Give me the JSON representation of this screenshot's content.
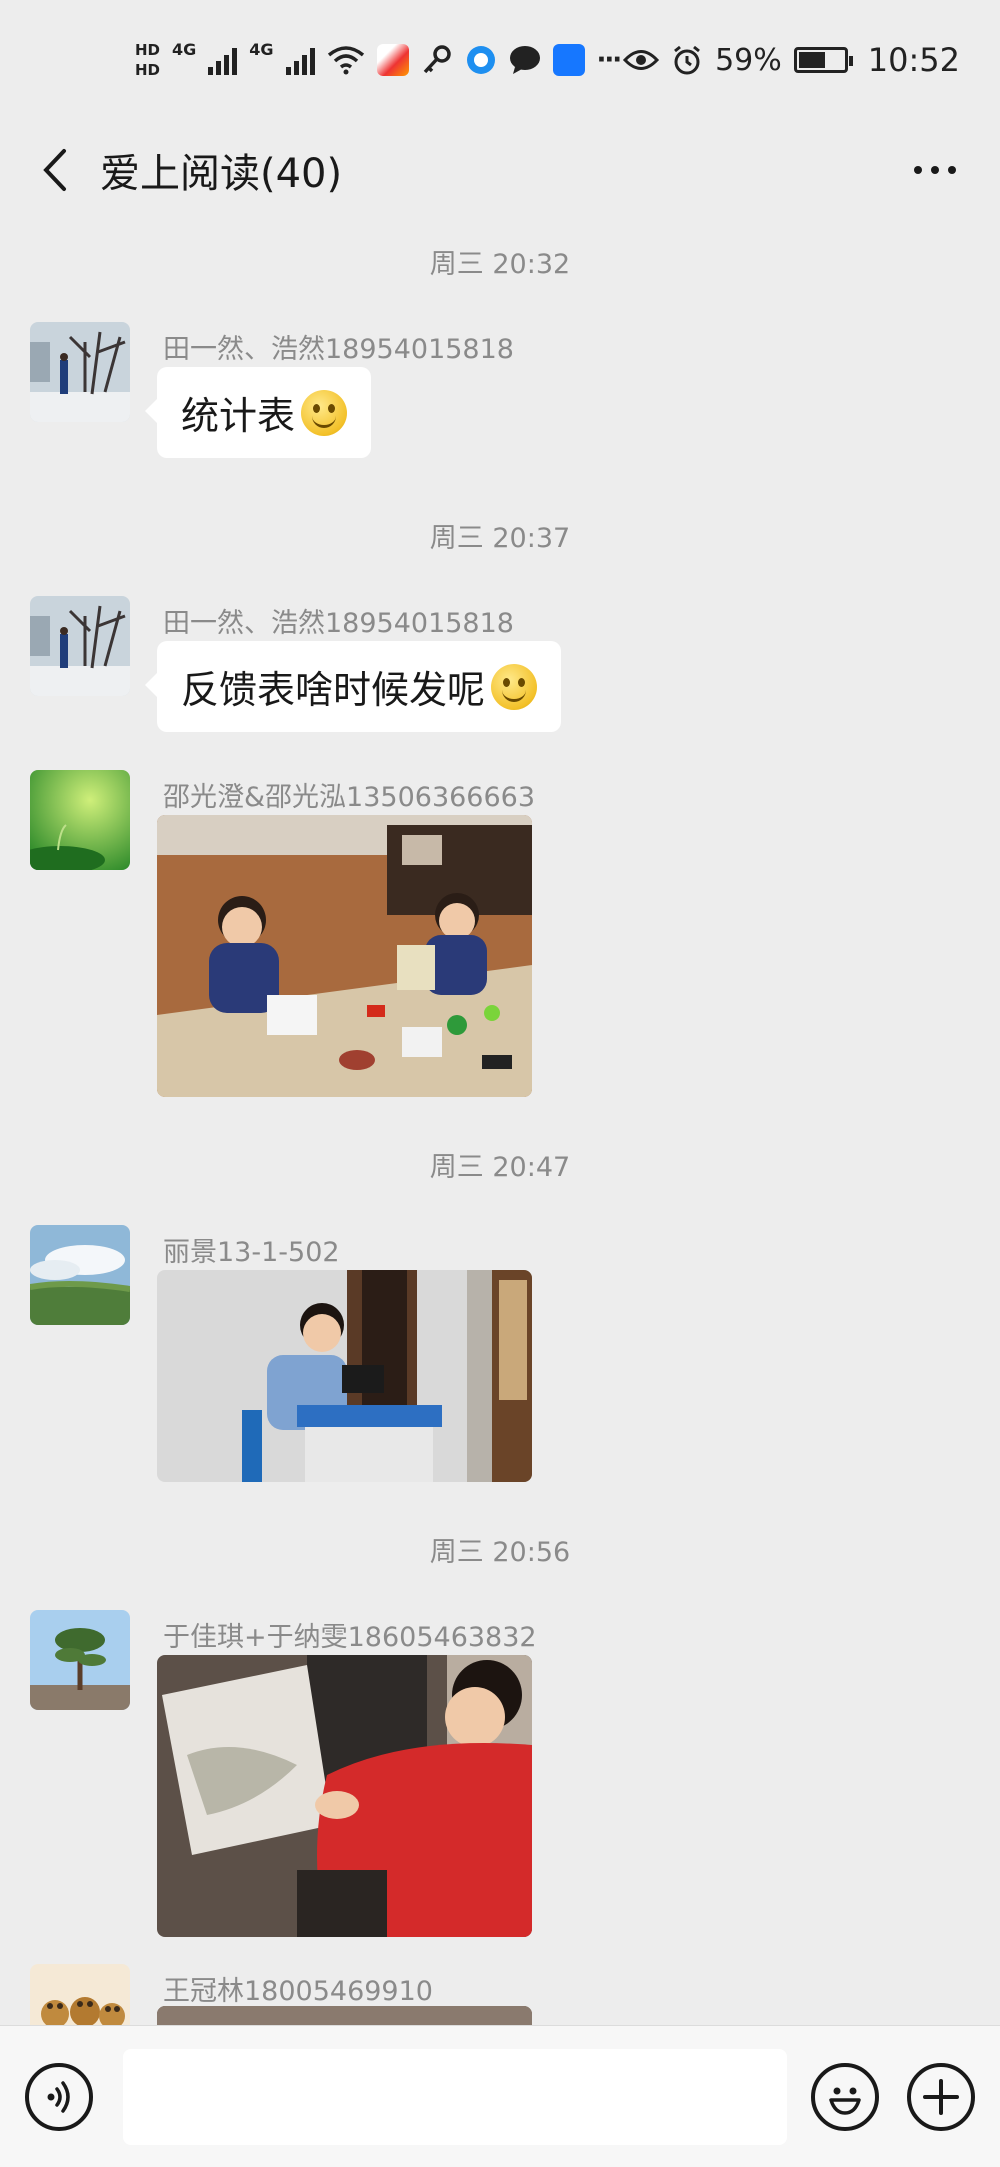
{
  "status_bar": {
    "hd1": "HD",
    "hd2": "HD",
    "net1": "4G",
    "net2": "4G",
    "more": "···",
    "battery": "59%",
    "time": "10:52"
  },
  "header": {
    "title": "爱上阅读(40)"
  },
  "messages": [
    {
      "time": "周三 20:32",
      "sender": "田一然、浩然18954015818",
      "text": "统计表"
    },
    {
      "time": "周三 20:37",
      "sender": "田一然、浩然18954015818",
      "text": "反馈表啥时候发呢"
    },
    {
      "sender": "邵光澄&邵光泓13506366663"
    },
    {
      "time": "周三 20:47",
      "sender": "丽景13-1-502"
    },
    {
      "time": "周三 20:56",
      "sender": "于佳琪+于纳雯18605463832"
    },
    {
      "sender": "王冠林18005469910"
    }
  ],
  "input_bar": {
    "placeholder": ""
  },
  "colors": {
    "background": "#ededed",
    "bubble": "#ffffff",
    "meta_text": "#8a8a8a"
  }
}
